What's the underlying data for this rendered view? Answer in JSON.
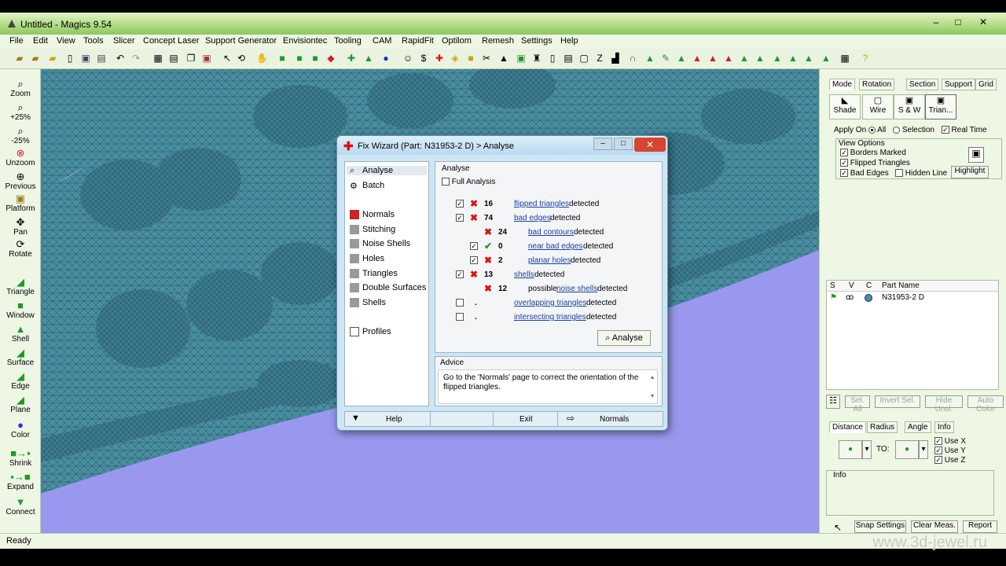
{
  "window": {
    "title": "Untitled - Magics 9.54",
    "minimize": "–",
    "maximize": "□",
    "close": "✕"
  },
  "menu": [
    "File",
    "Edit",
    "View",
    "Tools",
    "Slicer",
    "Concept Laser",
    "Support Generator",
    "Envisiontec",
    "Tooling",
    "CAM",
    "RapidFit",
    "Optilom",
    "Remesh",
    "Settings",
    "Help"
  ],
  "left_tools": {
    "zoom": "Zoom",
    "zoom_in": "+25%",
    "zoom_out": "-25%",
    "unzoom": "Unzoom",
    "previous": "Previous",
    "platform": "Platform",
    "pan": "Pan",
    "rotate": "Rotate",
    "triangle": "Triangle",
    "window": "Window",
    "shell": "Shell",
    "surface": "Surface",
    "edge": "Edge",
    "plane": "Plane",
    "color": "Color",
    "shrink": "Shrink",
    "expand": "Expand",
    "connect": "Connect"
  },
  "status": {
    "text": "Ready",
    "watermark": "www.3d-jewel.ru"
  },
  "right_panel": {
    "tabs": [
      "Mode",
      "Rotation",
      "Section",
      "Support",
      "Grid"
    ],
    "modes": [
      "Shade",
      "Wire",
      "S & W",
      "Trian..."
    ],
    "apply_on": "Apply On",
    "all": "All",
    "selection": "Selection",
    "real_time": "Real Time",
    "view_options": "View Options",
    "borders_marked": "Borders Marked",
    "flipped_triangles": "Flipped Triangles",
    "bad_edges": "Bad Edges",
    "hidden_line": "Hidden Line",
    "highlight": "Highlight",
    "parts_cols": [
      "S",
      "V",
      "C",
      "Part Name"
    ],
    "part_name": "N31953-2 D",
    "sel_all": "Sel. All",
    "invert_sel": "Invert Sel.",
    "hide_unsl": "Hide Unsl.",
    "auto_color": "Auto Color",
    "meas_tabs": [
      "Distance",
      "Radius",
      "Angle",
      "Info"
    ],
    "to": "TO:",
    "use_x": "Use X",
    "use_y": "Use Y",
    "use_z": "Use Z",
    "info": "Info",
    "snap_settings": "Snap Settings",
    "clear_meas": "Clear Meas.",
    "report": "Report"
  },
  "dialog": {
    "title": "Fix Wizard (Part: N31953-2 D) > Analyse",
    "nav_top": [
      "Analyse",
      "Batch"
    ],
    "nav_mid": [
      "Normals",
      "Stitching",
      "Noise Shells",
      "Holes",
      "Triangles",
      "Double Surfaces",
      "Shells"
    ],
    "nav_bottom": "Profiles",
    "analyse_label": "Analyse",
    "full_analysis": "Full Analysis",
    "rows": {
      "flipped": {
        "count": "16",
        "link": "flipped triangles",
        "suffix": "detected"
      },
      "bad_edges": {
        "count": "74",
        "link": "bad edges",
        "suffix": "detected"
      },
      "bad_contours": {
        "count": "24",
        "link": "bad contours",
        "suffix": "detected"
      },
      "near_bad": {
        "count": "0",
        "link": "near bad edges",
        "suffix": "detected"
      },
      "planar_holes": {
        "count": "2",
        "link": "planar holes",
        "suffix": "detected"
      },
      "shells": {
        "count": "13",
        "link": "shells",
        "suffix": "detected"
      },
      "noise": {
        "count": "12",
        "prefix": "possible",
        "link": "noise shells",
        "suffix": "detected"
      },
      "overlapping": {
        "count": ".",
        "link": "overlapping triangles",
        "suffix": "detected"
      },
      "intersecting": {
        "count": ".",
        "link": "intersecting triangles",
        "suffix": "detected"
      }
    },
    "analyse_button": "Analyse",
    "advice_label": "Advice",
    "advice_text": "Go to the 'Normals' page to correct the orientation of the flipped triangles.",
    "help": "Help",
    "exit": "Exit",
    "normals": "Normals"
  },
  "colors": {
    "viewport_bg": "#9a98ee",
    "mesh": "#4a8ea2",
    "accent_green": "#8cc85e",
    "close_red": "#d6452f"
  }
}
